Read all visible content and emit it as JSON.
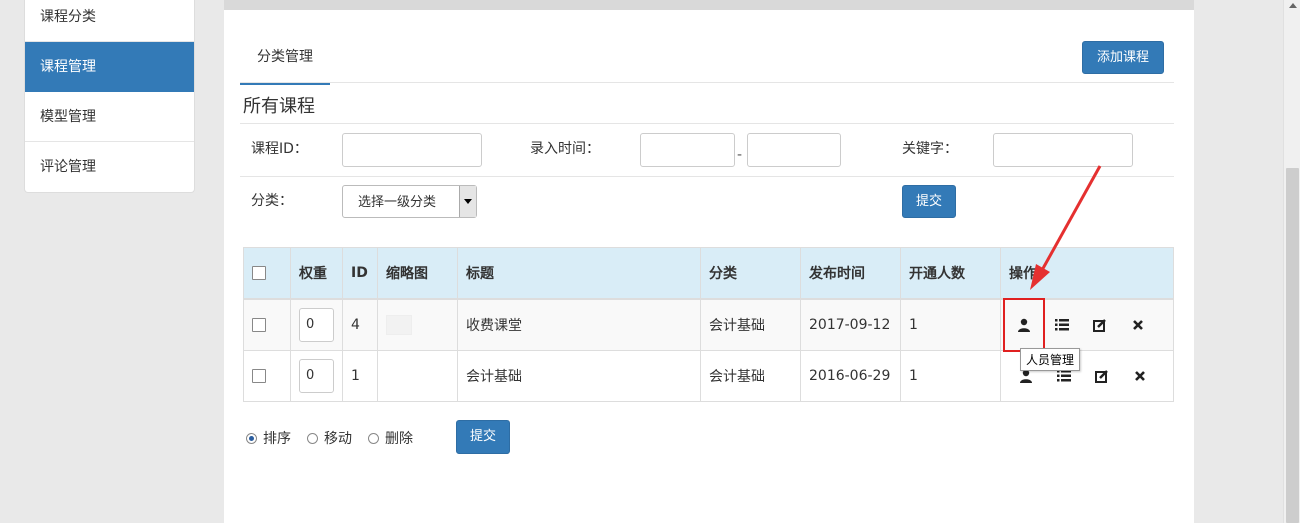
{
  "sidebar": {
    "items": [
      {
        "label": "课程分类"
      },
      {
        "label": "课程管理"
      },
      {
        "label": "模型管理"
      },
      {
        "label": "评论管理"
      }
    ]
  },
  "tabs": [
    {
      "label": "分类管理"
    }
  ],
  "toolbar": {
    "add_label": "添加课程"
  },
  "section_title": "所有课程",
  "filters": {
    "course_id_label": "课程ID：",
    "entry_time_label": "录入时间：",
    "range_dash": "-",
    "keyword_label": "关键字：",
    "category_label": "分类：",
    "category_select": "选择一级分类",
    "submit_label": "提交"
  },
  "table": {
    "headers": [
      "权重",
      "ID",
      "缩略图",
      "标题",
      "分类",
      "发布时间",
      "开通人数",
      "操作"
    ],
    "rows": [
      {
        "weight": "0",
        "id": "4",
        "title": "收费课堂",
        "category": "会计基础",
        "date": "2017-09-12",
        "count": "1"
      },
      {
        "weight": "0",
        "id": "1",
        "title": "会计基础",
        "category": "会计基础",
        "date": "2016-06-29",
        "count": "1"
      }
    ]
  },
  "tooltip": "人员管理",
  "bulk": {
    "options": [
      "排序",
      "移动",
      "删除"
    ],
    "submit_label": "提交"
  },
  "colors": {
    "primary": "#337ab7",
    "header_bg": "#d9edf7",
    "highlight": "#e02020"
  }
}
